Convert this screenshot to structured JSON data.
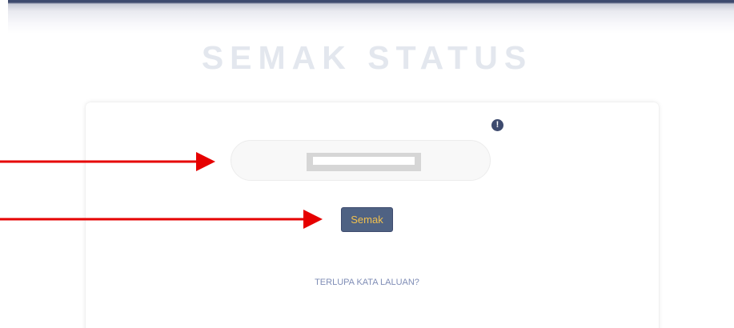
{
  "header": {
    "title": "SEMAK STATUS"
  },
  "form": {
    "info_icon": "exclamation-icon",
    "input_value": "",
    "submit_label": "Semak",
    "forgot_password_label": "TERLUPA KATA LALUAN?"
  },
  "annotations": {
    "arrow_color": "#e60000"
  },
  "colors": {
    "brand_navy": "#3d4a6e",
    "button_background": "#4f6283",
    "button_text": "#f2c14e",
    "link_text": "#7f8db6",
    "title_text": "#e3e7ee"
  }
}
